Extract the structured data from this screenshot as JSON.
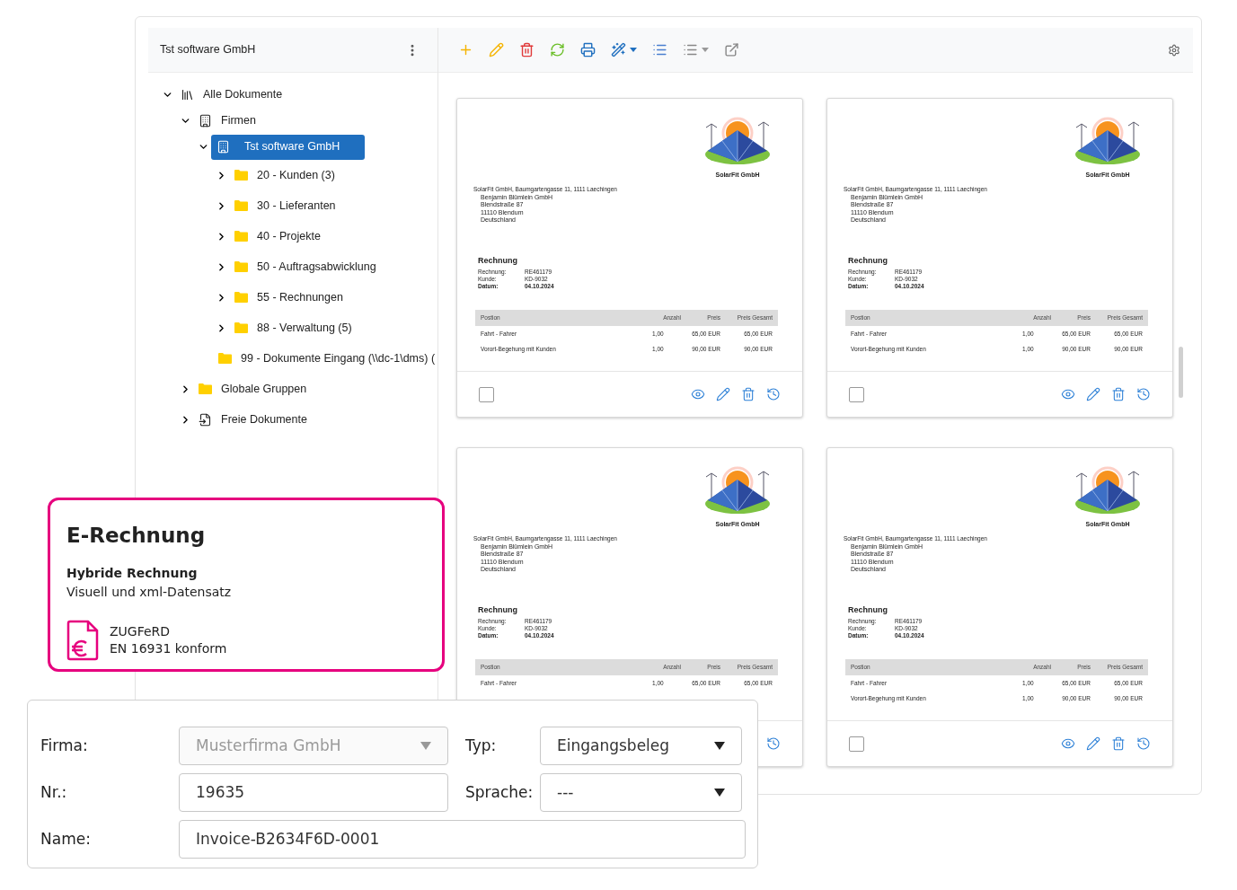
{
  "sidebar": {
    "title": "Tst software GmbH",
    "tree": [
      {
        "label": "Alle Dokumente",
        "kind": "library",
        "expandable": true,
        "expanded": true,
        "selected": false,
        "children": [
          {
            "label": "Firmen",
            "kind": "building",
            "expandable": true,
            "expanded": true,
            "selected": false,
            "children": [
              {
                "label": "Tst software GmbH",
                "kind": "building",
                "expandable": true,
                "expanded": true,
                "selected": true,
                "children": [
                  {
                    "label": "20 - Kunden (3)",
                    "kind": "folder",
                    "expandable": true,
                    "expanded": false,
                    "selected": false
                  },
                  {
                    "label": "30 - Lieferanten",
                    "kind": "folder",
                    "expandable": true,
                    "expanded": false,
                    "selected": false
                  },
                  {
                    "label": "40 - Projekte",
                    "kind": "folder",
                    "expandable": true,
                    "expanded": false,
                    "selected": false
                  },
                  {
                    "label": "50 - Auftragsabwicklung",
                    "kind": "folder",
                    "expandable": true,
                    "expanded": false,
                    "selected": false
                  },
                  {
                    "label": "55 - Rechnungen",
                    "kind": "folder",
                    "expandable": true,
                    "expanded": false,
                    "selected": false
                  },
                  {
                    "label": "88 - Verwaltung (5)",
                    "kind": "folder",
                    "expandable": true,
                    "expanded": false,
                    "selected": false
                  },
                  {
                    "label": "99 - Dokumente Eingang (\\\\dc-1\\dms) (",
                    "kind": "folder",
                    "expandable": false,
                    "expanded": false,
                    "selected": false
                  }
                ]
              }
            ]
          },
          {
            "label": "Globale Gruppen",
            "kind": "folder",
            "expandable": true,
            "expanded": false,
            "selected": false
          },
          {
            "label": "Freie Dokumente",
            "kind": "import",
            "expandable": true,
            "expanded": false,
            "selected": false
          }
        ]
      }
    ]
  },
  "documents": [
    {
      "checked": false,
      "company": "SolarFit GmbH",
      "sender": "SolarFit GmbH, Baumgartengasse 11, 1111 Laechingen",
      "address": [
        "Benjamin Blümlein GmbH",
        "Blendstraße 87",
        "11110 Blendum",
        "Deutschland"
      ],
      "title": "Rechnung",
      "meta": [
        {
          "label": "Rechnung:",
          "value": "RE461179",
          "bold": false
        },
        {
          "label": "Kunde:",
          "value": "KD-9032",
          "bold": false
        },
        {
          "label": "Datum:",
          "value": "04.10.2024",
          "bold": true
        }
      ],
      "columns": [
        "Postion",
        "Anzahl",
        "Preis",
        "Preis Gesamt"
      ],
      "rows": [
        [
          "Fahrt - Fahrer",
          "1,00",
          "65,00 EUR",
          "65,00 EUR"
        ],
        [
          "Vorort-Begehung mit Kunden",
          "1,00",
          "90,00 EUR",
          "90,00 EUR"
        ]
      ]
    },
    {
      "checked": false,
      "company": "SolarFit GmbH",
      "sender": "SolarFit GmbH, Baumgartengasse 11, 1111 Laechingen",
      "address": [
        "Benjamin Blümlein GmbH",
        "Blendstraße 87",
        "11110 Blendum",
        "Deutschland"
      ],
      "title": "Rechnung",
      "meta": [
        {
          "label": "Rechnung:",
          "value": "RE461179",
          "bold": false
        },
        {
          "label": "Kunde:",
          "value": "KD-9032",
          "bold": false
        },
        {
          "label": "Datum:",
          "value": "04.10.2024",
          "bold": true
        }
      ],
      "columns": [
        "Postion",
        "Anzahl",
        "Preis",
        "Preis Gesamt"
      ],
      "rows": [
        [
          "Fahrt - Fahrer",
          "1,00",
          "65,00 EUR",
          "65,00 EUR"
        ],
        [
          "Vorort-Begehung mit Kunden",
          "1,00",
          "90,00 EUR",
          "90,00 EUR"
        ]
      ]
    },
    {
      "company": "SolarFit GmbH",
      "sender": "SolarFit GmbH, Baumgartengasse 11, 1111 Laechingen",
      "address": [
        "Benjamin Blümlein GmbH",
        "Blendstraße 87",
        "11110 Blendum",
        "Deutschland"
      ],
      "title": "Rechnung",
      "meta": [
        {
          "label": "Rechnung:",
          "value": "RE461179",
          "bold": false
        },
        {
          "label": "Kunde:",
          "value": "KD-9032",
          "bold": false
        },
        {
          "label": "Datum:",
          "value": "04.10.2024",
          "bold": true
        }
      ],
      "columns": [
        "Postion",
        "Anzahl",
        "Preis",
        "Preis Gesamt"
      ],
      "rows": [
        [
          "Fahrt - Fahrer",
          "1,00",
          "65,00 EUR",
          "65,00 EUR"
        ]
      ]
    },
    {
      "checked": false,
      "company": "SolarFit GmbH",
      "sender": "SolarFit GmbH, Baumgartengasse 11, 1111 Laechingen",
      "address": [
        "Benjamin Blümlein GmbH",
        "Blendstraße 87",
        "11110 Blendum",
        "Deutschland"
      ],
      "title": "Rechnung",
      "meta": [
        {
          "label": "Rechnung:",
          "value": "RE461179",
          "bold": false
        },
        {
          "label": "Kunde:",
          "value": "KD-9032",
          "bold": false
        },
        {
          "label": "Datum:",
          "value": "04.10.2024",
          "bold": true
        }
      ],
      "columns": [
        "Postion",
        "Anzahl",
        "Preis",
        "Preis Gesamt"
      ],
      "rows": [
        [
          "Fahrt - Fahrer",
          "1,00",
          "65,00 EUR",
          "65,00 EUR"
        ],
        [
          "Vorort-Begehung mit Kunden",
          "1,00",
          "90,00 EUR",
          "90,00 EUR"
        ]
      ]
    }
  ],
  "callout": {
    "title": "E-Rechnung",
    "subtitle": "Hybride Rechnung",
    "description": "Visuell und xml-Datensatz",
    "feature_lines": [
      "ZUGFeRD",
      "EN 16931 konform"
    ]
  },
  "form": {
    "fields": [
      {
        "label": "Firma:",
        "kind": "select",
        "value": "Musterfirma GmbH",
        "disabled": true
      },
      {
        "label": "Typ:",
        "kind": "select",
        "value": "Eingangsbeleg",
        "disabled": false
      },
      {
        "label": "Nr.:",
        "kind": "input",
        "value": "19635",
        "disabled": false
      },
      {
        "label": "Sprache:",
        "kind": "select",
        "value": "---",
        "disabled": false
      },
      {
        "label": "Name:",
        "kind": "input",
        "value": "Invoice-B2634F6D-0001",
        "disabled": false
      }
    ]
  }
}
